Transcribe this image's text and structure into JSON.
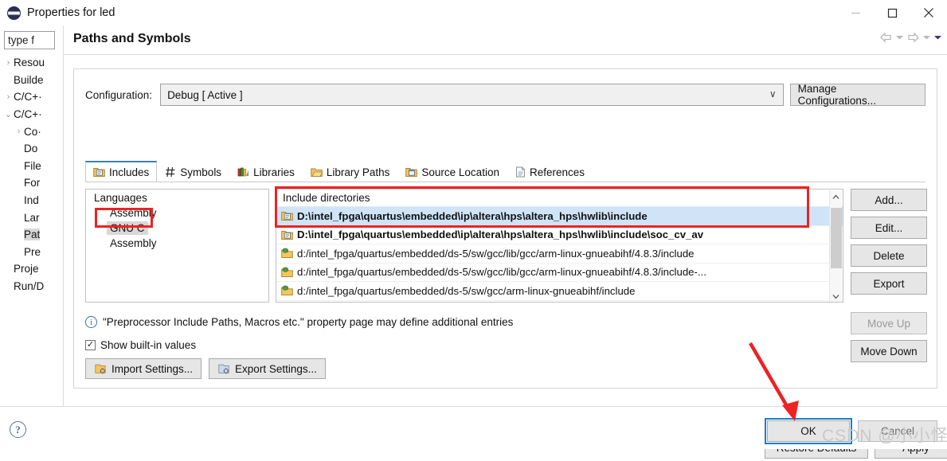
{
  "window": {
    "title": "Properties for led",
    "icon": "eclipse-icon",
    "controls": {
      "minimize": "minimize-icon",
      "maximize": "maximize-icon",
      "close": "close-icon"
    }
  },
  "sidebar": {
    "filter": {
      "value": "type f",
      "placeholder": "type filter text"
    },
    "items": [
      {
        "label": "Resou",
        "twisty": "›",
        "indent": 0,
        "selected": false
      },
      {
        "label": "Builde",
        "twisty": "",
        "indent": 0,
        "selected": false
      },
      {
        "label": "C/C+·",
        "twisty": "›",
        "indent": 0,
        "selected": false
      },
      {
        "label": "C/C+·",
        "twisty": "⌄",
        "indent": 0,
        "selected": false
      },
      {
        "label": "Co·",
        "twisty": "›",
        "indent": 1,
        "selected": false
      },
      {
        "label": "Do",
        "twisty": "",
        "indent": 1,
        "selected": false
      },
      {
        "label": "File",
        "twisty": "",
        "indent": 1,
        "selected": false
      },
      {
        "label": "For",
        "twisty": "",
        "indent": 1,
        "selected": false
      },
      {
        "label": "Ind",
        "twisty": "",
        "indent": 1,
        "selected": false
      },
      {
        "label": "Lar",
        "twisty": "",
        "indent": 1,
        "selected": false
      },
      {
        "label": "Pat",
        "twisty": "",
        "indent": 1,
        "selected": true
      },
      {
        "label": "Pre",
        "twisty": "",
        "indent": 1,
        "selected": false
      },
      {
        "label": "Proje",
        "twisty": "",
        "indent": 0,
        "selected": false
      },
      {
        "label": "Run/D",
        "twisty": "",
        "indent": 0,
        "selected": false
      }
    ],
    "hscroll": {
      "left": "‹",
      "right": "›"
    }
  },
  "panel": {
    "title": "Paths and Symbols",
    "nav": {
      "back": "back-arrow-icon",
      "back_menu": "chevron-down-icon",
      "forward": "forward-arrow-icon",
      "forward_menu": "chevron-down-icon",
      "view_menu": "chevron-down-icon"
    }
  },
  "configuration": {
    "label": "Configuration:",
    "value": "Debug  [ Active ]",
    "chevron": "∨",
    "manage_label": "Manage Configurations..."
  },
  "tabs": [
    {
      "label": "Includes",
      "icon": "include-folder-icon",
      "active": true
    },
    {
      "label": "Symbols",
      "icon": "hash-icon",
      "active": false
    },
    {
      "label": "Libraries",
      "icon": "books-icon",
      "active": false
    },
    {
      "label": "Library Paths",
      "icon": "folder-open-icon",
      "active": false
    },
    {
      "label": "Source Location",
      "icon": "source-folder-icon",
      "active": false
    },
    {
      "label": "References",
      "icon": "reference-page-icon",
      "active": false
    }
  ],
  "languages": {
    "header": "Languages",
    "items": [
      {
        "label": "Assembly",
        "selected": false
      },
      {
        "label": "GNU C",
        "selected": true
      },
      {
        "label": "Assembly",
        "selected": false
      }
    ]
  },
  "include_directories": {
    "header": "Include directories",
    "rows": [
      {
        "path": "D:\\intel_fpga\\quartus\\embedded\\ip\\altera\\hps\\altera_hps\\hwlib\\include",
        "kind": "user",
        "icon": "include-folder-icon",
        "highlighted": true
      },
      {
        "path": "D:\\intel_fpga\\quartus\\embedded\\ip\\altera\\hps\\altera_hps\\hwlib\\include\\soc_cv_av",
        "kind": "user",
        "icon": "include-folder-icon",
        "highlighted": false
      },
      {
        "path": "d:/intel_fpga/quartus/embedded/ds-5/sw/gcc/lib/gcc/arm-linux-gnueabihf/4.8.3/include",
        "kind": "builtin",
        "icon": "builtin-folder-icon",
        "highlighted": false
      },
      {
        "path": "d:/intel_fpga/quartus/embedded/ds-5/sw/gcc/lib/gcc/arm-linux-gnueabihf/4.8.3/include-...",
        "kind": "builtin",
        "icon": "builtin-folder-icon",
        "highlighted": false
      },
      {
        "path": "d:/intel_fpga/quartus/embedded/ds-5/sw/gcc/arm-linux-gnueabihf/include",
        "kind": "builtin",
        "icon": "builtin-folder-icon",
        "highlighted": false
      }
    ],
    "scrollbar": {
      "up": "▲",
      "down": "▼"
    }
  },
  "side_buttons": [
    {
      "label": "Add...",
      "enabled": true
    },
    {
      "label": "Edit...",
      "enabled": true
    },
    {
      "label": "Delete",
      "enabled": true
    },
    {
      "label": "Export",
      "enabled": true
    },
    {
      "label": "Move Up",
      "enabled": false
    },
    {
      "label": "Move Down",
      "enabled": true
    }
  ],
  "info": {
    "icon": "info-icon",
    "text": "\"Preprocessor Include Paths, Macros etc.\" property page may define additional entries"
  },
  "show_builtin": {
    "label": "Show built-in values",
    "checked": true,
    "check_glyph": "✓"
  },
  "settings_buttons": [
    {
      "label": "Import Settings...",
      "icon": "import-icon"
    },
    {
      "label": "Export Settings...",
      "icon": "export-icon"
    }
  ],
  "footer": {
    "restore_defaults": "Restore Defaults",
    "apply": "Apply",
    "ok": "OK",
    "cancel": "Cancel",
    "help": "?"
  },
  "annotations": {
    "watermark": "CSDN @小小怪",
    "highlight_color": "#ee2222",
    "focus_ring_color": "#1a7fd4",
    "arrow": "red-arrow-pointing-to-ok"
  }
}
